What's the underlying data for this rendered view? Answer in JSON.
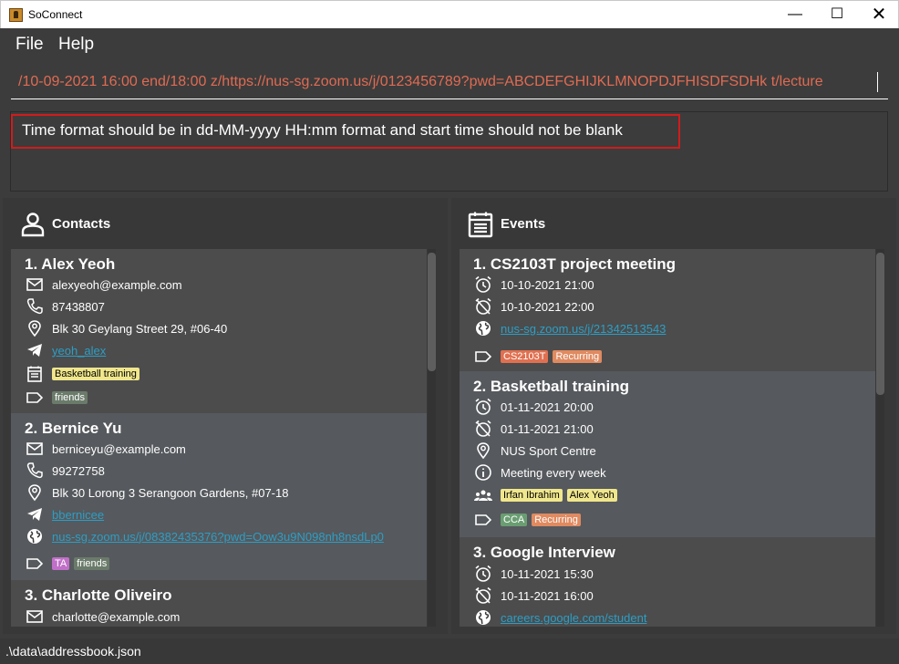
{
  "window": {
    "title": "SoConnect",
    "minimize": "—",
    "maximize": "☐",
    "close": "✕"
  },
  "menu": {
    "file": "File",
    "help": "Help"
  },
  "command": {
    "value": "/10-09-2021 16:00 end/18:00 z/https://nus-sg.zoom.us/j/0123456789?pwd=ABCDEFGHIJKLMNOPDJFHISDFSDHk t/lecture"
  },
  "result": {
    "message": "Time format should be in  dd-MM-yyyy HH:mm format and start time should not be blank"
  },
  "contacts": {
    "header": "Contacts",
    "items": [
      {
        "title": "1.  Alex Yeoh",
        "email": "alexyeoh@example.com",
        "phone": "87438807",
        "address": "Blk 30 Geylang Street 29, #06-40",
        "telegram": "yeoh_alex",
        "event_tags": [
          "Basketball training"
        ],
        "tags": [
          "friends"
        ]
      },
      {
        "title": "2.  Bernice Yu",
        "email": "berniceyu@example.com",
        "phone": "99272758",
        "address": "Blk 30 Lorong 3 Serangoon Gardens, #07-18",
        "telegram": "bbernicee",
        "zoom": "nus-sg.zoom.us/j/08382435376?pwd=Oow3u9N098nh8nsdLp0",
        "tags": [
          "TA",
          "friends"
        ]
      },
      {
        "title": "3.  Charlotte Oliveiro",
        "email": "charlotte@example.com"
      }
    ]
  },
  "events": {
    "header": "Events",
    "items": [
      {
        "title": "1.  CS2103T project meeting",
        "start": "10-10-2021 21:00",
        "end": "10-10-2021 22:00",
        "zoom": "nus-sg.zoom.us/j/21342513543",
        "tags": [
          "CS2103T",
          "Recurring"
        ]
      },
      {
        "title": "2.  Basketball training",
        "start": "01-11-2021 20:00",
        "end": "01-11-2021 21:00",
        "address": "NUS Sport Centre",
        "description": "Meeting every week",
        "participants": [
          "Irfan Ibrahim",
          "Alex Yeoh"
        ],
        "tags": [
          "CCA",
          "Recurring"
        ]
      },
      {
        "title": "3.  Google Interview",
        "start": "10-11-2021 15:30",
        "end": "10-11-2021 16:00",
        "zoom": "careers.google.com/student"
      }
    ]
  },
  "status": {
    "path": ".\\data\\addressbook.json"
  },
  "colors": {
    "tag_default": "#6b7b6b",
    "tag_ta": "#c070c8",
    "tag_cs2103t": "#e07050",
    "tag_recurring": "#e08a60",
    "tag_cca": "#6a9e72",
    "participant_tag": "#f0e68c",
    "link": "#2c9ec5",
    "error_border": "#d01c1c"
  }
}
